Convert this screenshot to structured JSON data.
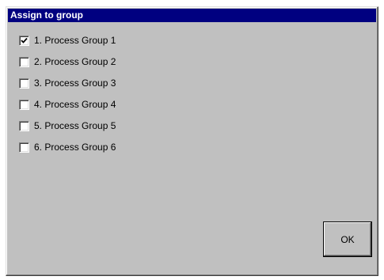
{
  "dialog": {
    "title": "Assign to group"
  },
  "groups": [
    {
      "label": "1. Process Group 1",
      "checked": true
    },
    {
      "label": "2. Process Group 2",
      "checked": false
    },
    {
      "label": "3. Process Group 3",
      "checked": false
    },
    {
      "label": "4. Process Group 4",
      "checked": false
    },
    {
      "label": "5. Process Group 5",
      "checked": false
    },
    {
      "label": "6. Process Group 6",
      "checked": false
    }
  ],
  "buttons": {
    "ok_label": "OK"
  },
  "colors": {
    "titlebar": "#000080",
    "dialog_face": "#c0c0c0"
  }
}
